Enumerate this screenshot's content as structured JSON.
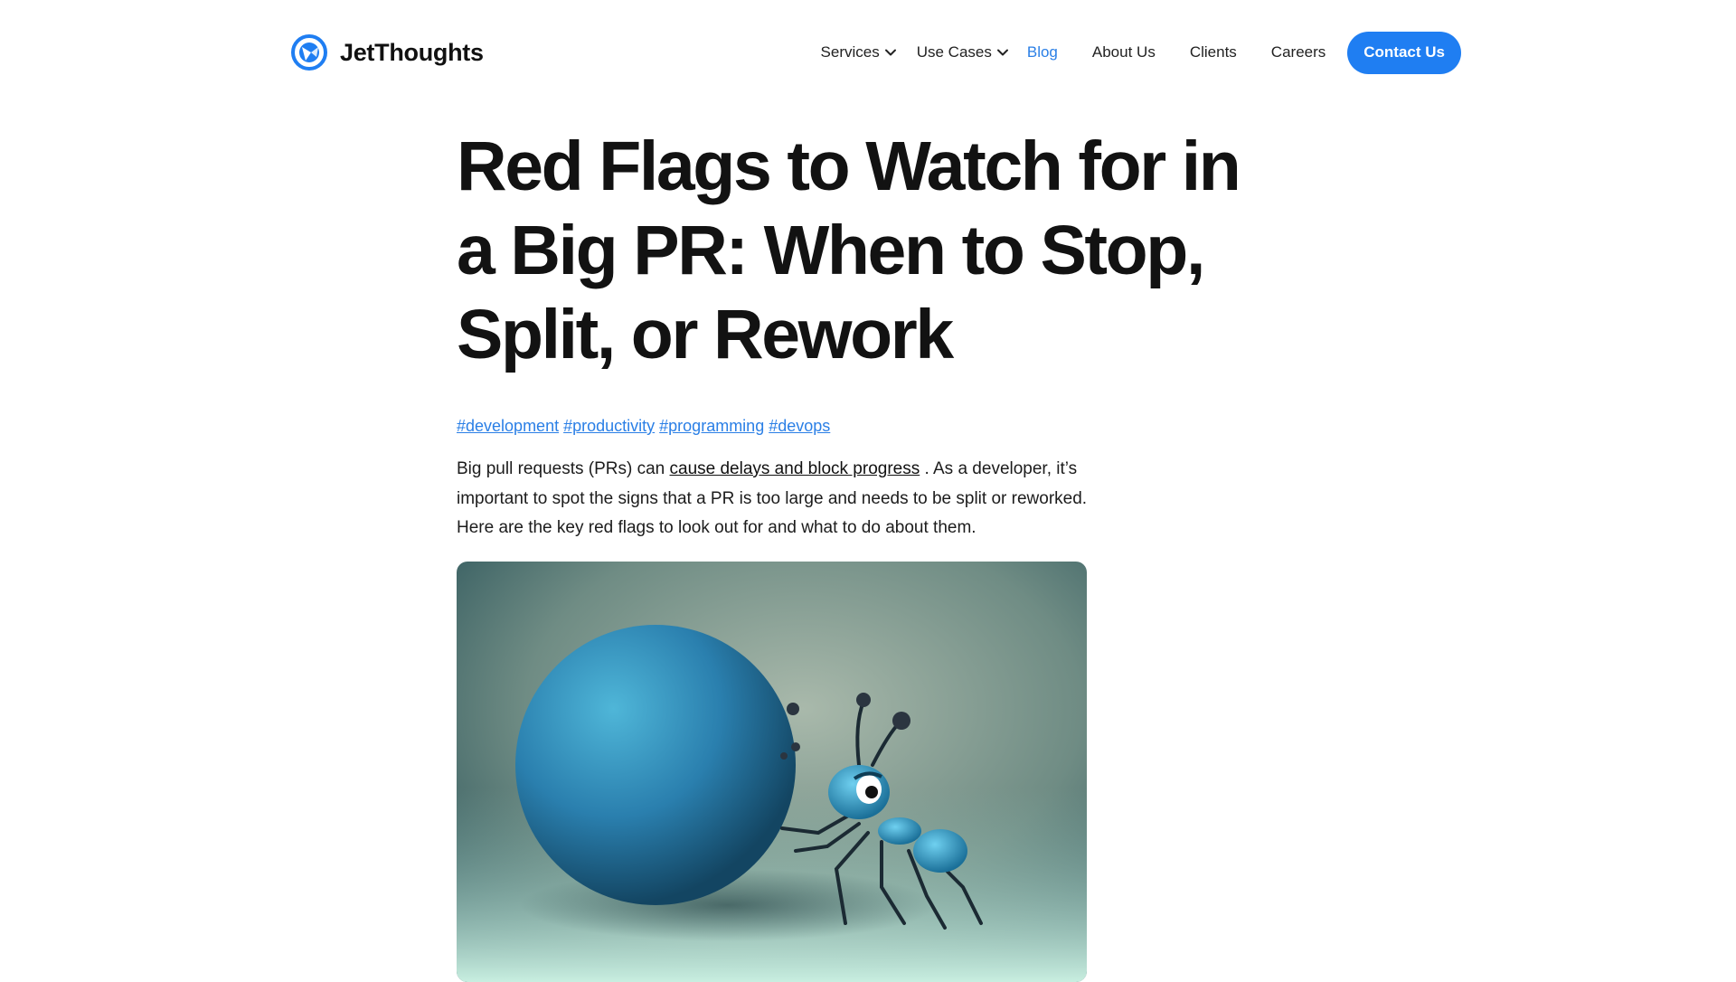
{
  "brand": {
    "name": "JetThoughts",
    "logo_icon": "jetthoughts-logo-icon"
  },
  "nav": {
    "items": [
      {
        "label": "Services",
        "dropdown": true
      },
      {
        "label": "Use Cases",
        "dropdown": true
      },
      {
        "label": "Blog",
        "active": true
      },
      {
        "label": "About Us"
      },
      {
        "label": "Clients"
      },
      {
        "label": "Careers"
      }
    ],
    "cta": "Contact Us"
  },
  "article": {
    "title": "Red Flags to Watch for in a Big PR: When to Stop, Split, or Rework",
    "tags": [
      "#development",
      "#productivity",
      "#programming",
      "#devops"
    ],
    "intro": {
      "before": "Big pull requests (PRs) can ",
      "link": "cause delays and block progress",
      "after": " . As a developer, it’s important to spot the signs that a PR is too large and needs to be split or reworked. Here are the key red flags to look out for and what to do about them."
    }
  },
  "colors": {
    "accent": "#1f7ef2",
    "link": "#2a7fe6",
    "text": "#121212"
  }
}
